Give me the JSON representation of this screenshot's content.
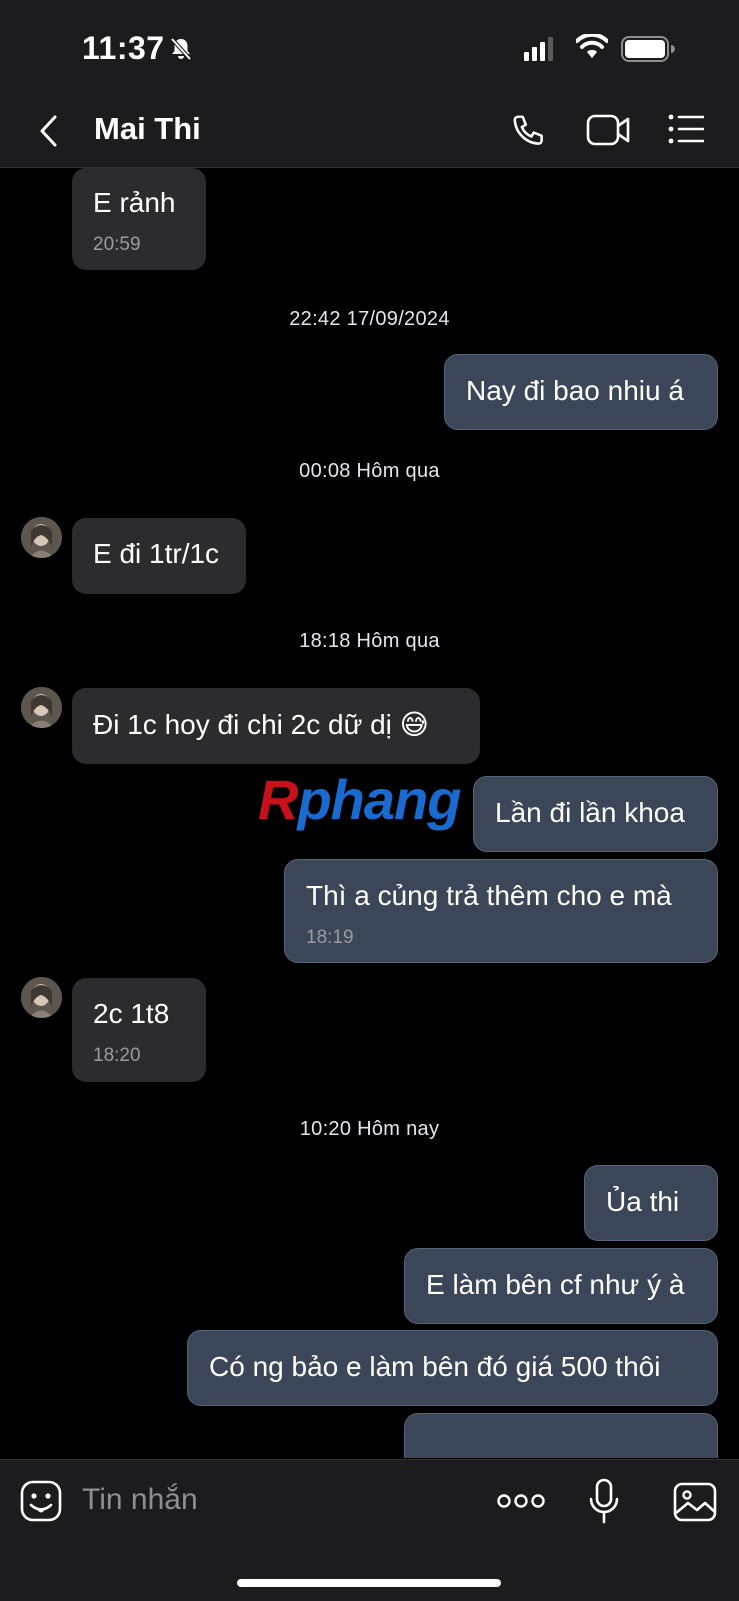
{
  "status": {
    "time": "11:37"
  },
  "header": {
    "title": "Mai Thi"
  },
  "messages": [
    {
      "text": "E rảnh",
      "time": "20:59"
    },
    {
      "separator": "22:42 17/09/2024"
    },
    {
      "text": "Nay đi bao nhiu á"
    },
    {
      "separator": "00:08 Hôm qua"
    },
    {
      "text": "E đi 1tr/1c"
    },
    {
      "separator": "18:18 Hôm qua"
    },
    {
      "text": "Đi 1c hoy đi chi 2c dữ dị 😅"
    },
    {
      "text": "Lần đi lần khoa"
    },
    {
      "text": "Thì a củng trả thêm cho e mà",
      "time": "18:19"
    },
    {
      "text": "2c 1t8",
      "time": "18:20"
    },
    {
      "separator": "10:20 Hôm nay"
    },
    {
      "text": "Ủa thi"
    },
    {
      "text": "E làm bên cf như ý à"
    },
    {
      "text": "Có ng bảo e làm bên đó giá 500 thôi"
    }
  ],
  "watermark": {
    "first": "R",
    "rest": "phang"
  },
  "input": {
    "placeholder": "Tin nhắn"
  },
  "colors": {
    "incoming_bubble": "#2c2c2e",
    "outgoing_bubble": "#3b4758",
    "background": "#000000",
    "bars": "#1c1c1e"
  }
}
